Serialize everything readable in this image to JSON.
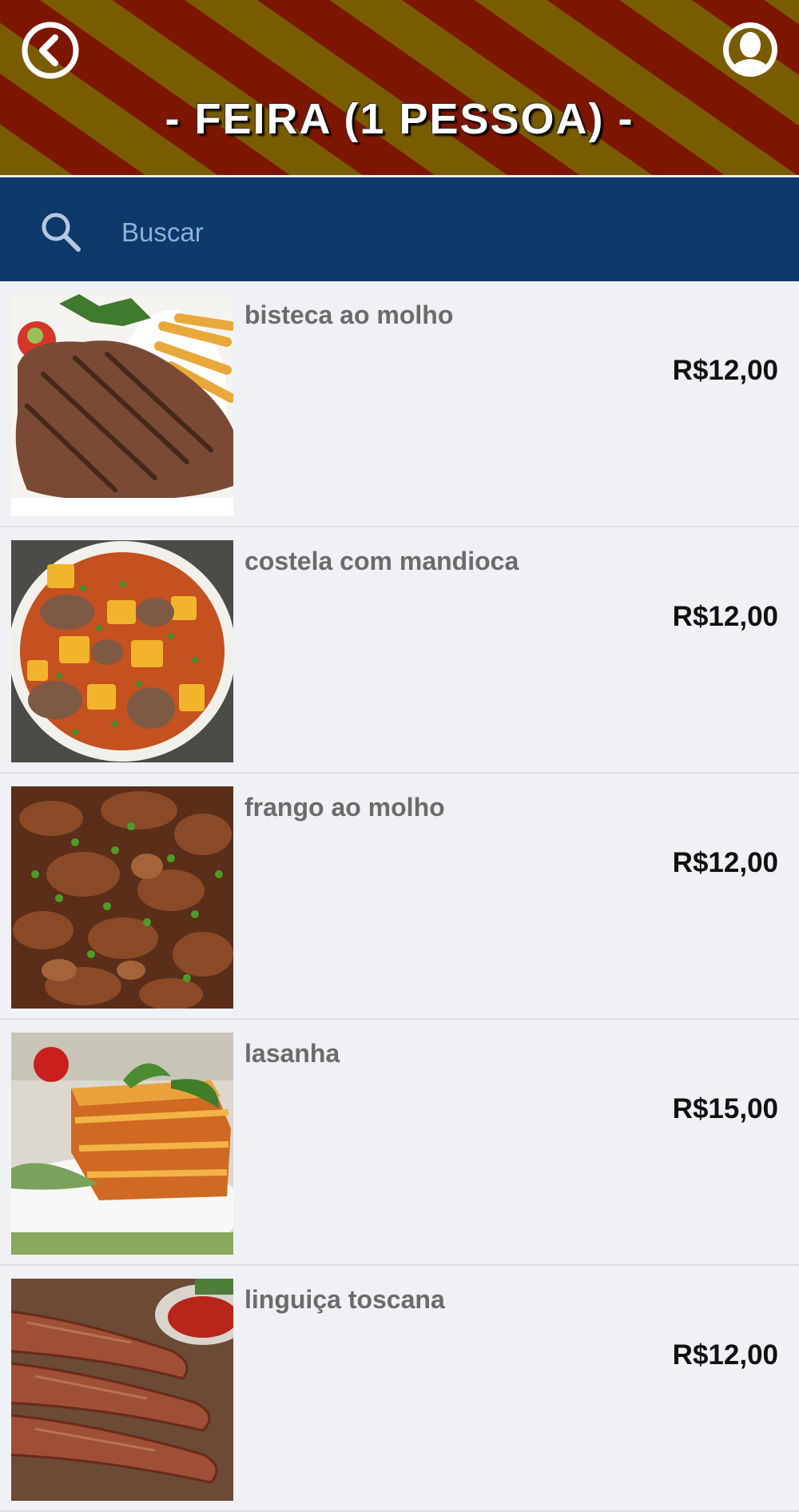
{
  "header": {
    "title": "- FEIRA (1 PESSOA) -",
    "back_icon": "chevron-left-circle-icon",
    "profile_icon": "user-silhouette-icon"
  },
  "search": {
    "placeholder": "Buscar",
    "icon": "search-icon"
  },
  "colors": {
    "stripe_gold": "#7a5c00",
    "stripe_red": "#7d1600",
    "search_bar": "#0e396b",
    "list_bg": "#eff1f4",
    "name_text": "#6b6b6b",
    "price_text": "#111111"
  },
  "items": [
    {
      "name": "bisteca ao molho",
      "price": "R$12,00",
      "image": "grilled-steak-with-fries"
    },
    {
      "name": "costela com mandioca",
      "price": "R$12,00",
      "image": "rib-stew-with-cassava"
    },
    {
      "name": "frango ao molho",
      "price": "R$12,00",
      "image": "chicken-in-sauce"
    },
    {
      "name": "lasanha",
      "price": "R$15,00",
      "image": "lasagna-slice"
    },
    {
      "name": "linguiça toscana",
      "price": "R$12,00",
      "image": "tuscan-sausages"
    }
  ]
}
